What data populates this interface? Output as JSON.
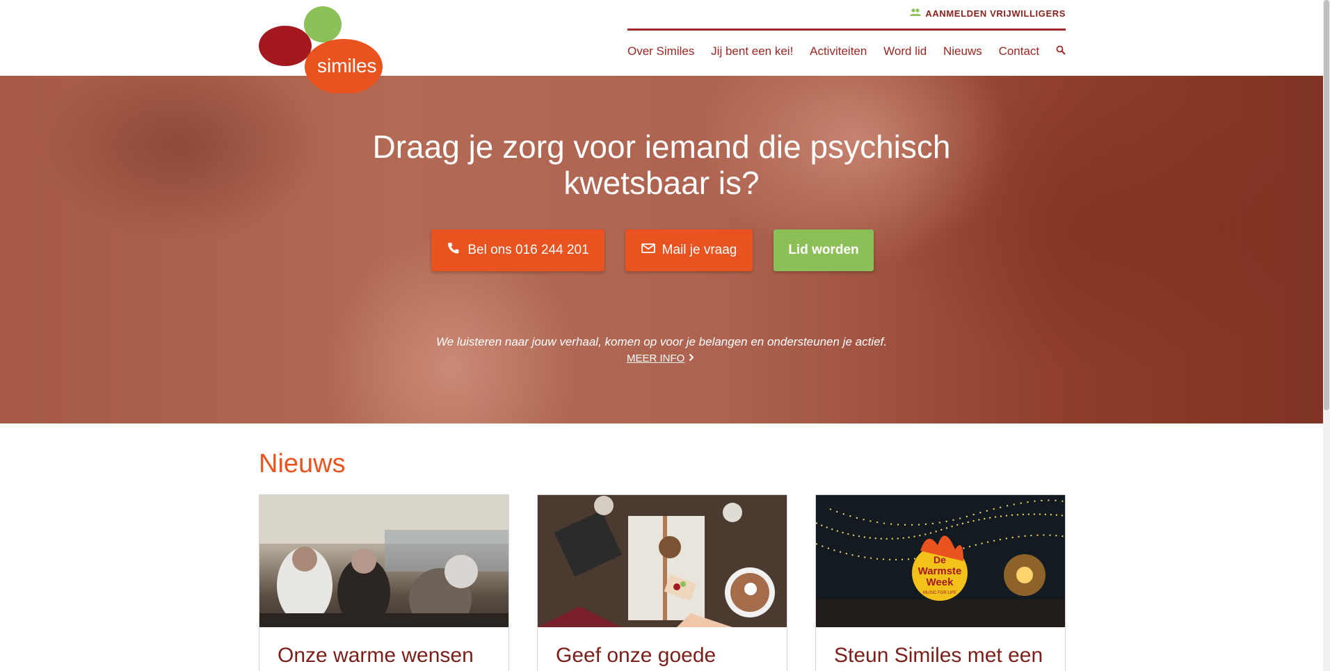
{
  "header": {
    "logo_text": "similes",
    "volunteer_link": "AANMELDEN VRIJWILLIGERS",
    "nav": [
      {
        "label": "Over Similes"
      },
      {
        "label": "Jij bent een kei!"
      },
      {
        "label": "Activiteiten"
      },
      {
        "label": "Word lid"
      },
      {
        "label": "Nieuws"
      },
      {
        "label": "Contact"
      }
    ]
  },
  "hero": {
    "title_line1": "Draag je zorg voor iemand die psychisch",
    "title_line2": "kwetsbaar is?",
    "buttons": {
      "call": "Bel ons 016 244 201",
      "mail": "Mail je vraag",
      "join": "Lid worden"
    },
    "subtitle": "We luisteren naar jouw verhaal, komen op voor je belangen en ondersteunen je actief.",
    "more_link": "MEER INFO"
  },
  "news": {
    "heading": "Nieuws",
    "cards": [
      {
        "title": "Onze warme wensen"
      },
      {
        "title": "Geef onze goede"
      },
      {
        "title": "Steun Similes met een"
      }
    ],
    "badge_text_1": "De",
    "badge_text_2": "Warmste",
    "badge_text_3": "Week",
    "badge_text_4": "MUSIC FOR LIFE"
  },
  "colors": {
    "brand_red": "#a3262a",
    "brand_orange": "#e8531f",
    "brand_green": "#8dbf59"
  },
  "icons": {
    "volunteer": "people-icon",
    "search": "search-icon",
    "phone": "phone-icon",
    "mail": "mail-icon",
    "more": "chevron-right-icon"
  }
}
